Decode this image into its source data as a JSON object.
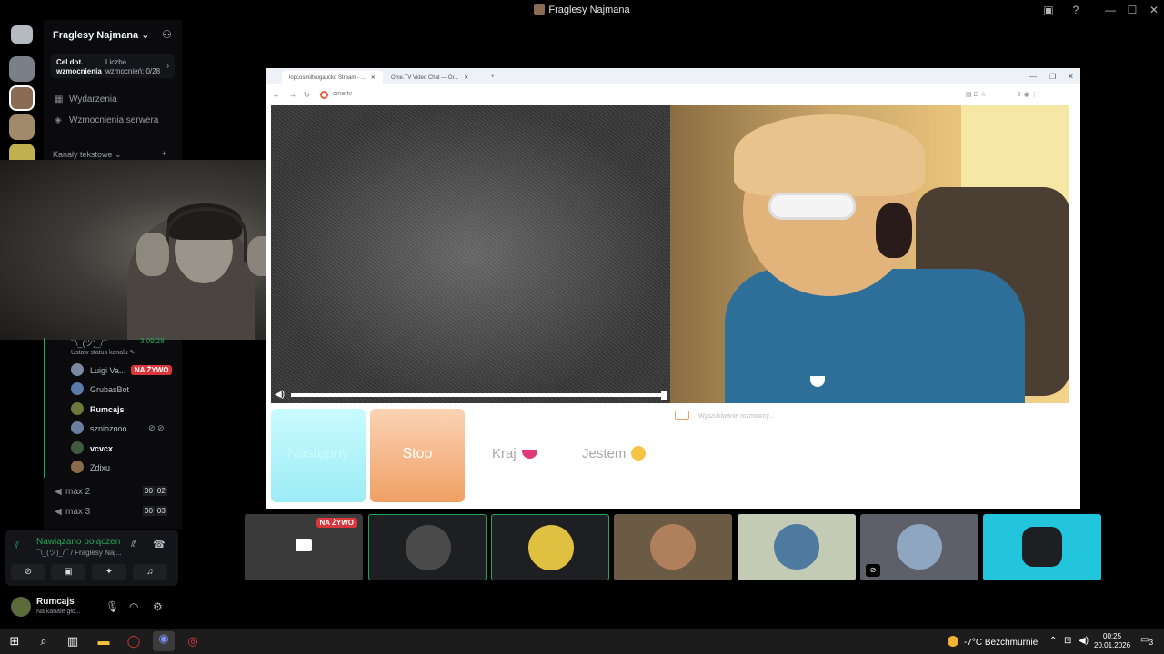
{
  "window": {
    "title": "Fraglesy Najmana",
    "controls": {
      "minimize": "—",
      "maximize": "☐",
      "close": "✕"
    }
  },
  "server": {
    "name": "Fraglesy Najmana",
    "boost": {
      "goal_label": "Cel dot. wzmocnienia",
      "count_label": "Liczba wzmocnień: 0/28"
    },
    "menu": [
      {
        "label": "Wydarzenia",
        "icon": "calendar-icon"
      },
      {
        "label": "Wzmocnienia serwera",
        "icon": "boost-icon"
      }
    ],
    "category": "Kanały tekstowe"
  },
  "voice_channel": {
    "name": "¯\\_(ツ)_/¯",
    "timer": "3:09:28",
    "status_placeholder": "Ustaw status kanału",
    "members": [
      {
        "name": "Luigi Va...",
        "live": "NA ŻYWO",
        "color": "#7a8aa0"
      },
      {
        "name": "GrubasBot",
        "color": "#5a7aa8"
      },
      {
        "name": "Rumcajs",
        "bold": true,
        "color": "#6b7a3c"
      },
      {
        "name": "szniozooo",
        "color": "#6a7fa0"
      },
      {
        "name": "vcvcx",
        "bold": true,
        "color": "#3f5a3f"
      },
      {
        "name": "Zdixu",
        "color": "#8a6a4a"
      }
    ],
    "other_channels": [
      {
        "name": "max 2",
        "a": "00",
        "b": "02"
      },
      {
        "name": "max 3",
        "a": "00",
        "b": "03"
      }
    ]
  },
  "voice_panel": {
    "status": "Nawiązano połączen",
    "channel": "¯\\_(ツ)_/¯ / Fraglesy Naj..."
  },
  "user": {
    "name": "Rumcajs",
    "status": "Na kanale gło..."
  },
  "browser": {
    "tabs": [
      {
        "title": "lopcosmiltvogaucko Stream - ..."
      },
      {
        "title": "Ome.TV Video Chat — Or..."
      }
    ],
    "url": "ome.tv",
    "buttons": {
      "next": "Następny",
      "stop": "Stop",
      "country": "Kraj",
      "gender": "Jestem"
    },
    "status": "Wyszukiwanie rozmowcy...",
    "progress": 1.0
  },
  "tiles": [
    {
      "bg": "#3a3a3a",
      "live": "NA ŻYWO",
      "screen": true,
      "speaking": false
    },
    {
      "bg": "#1e1f22",
      "avatar": "#4a4a4a",
      "speaking": true
    },
    {
      "bg": "#1e1f22",
      "avatar": "#e0c040",
      "speaking": true
    },
    {
      "bg": "#6b5a44",
      "avatar": "#b0805c",
      "speaking": false
    },
    {
      "bg": "#c4cbb5",
      "avatar": "#4f7aa0",
      "speaking": false
    },
    {
      "bg": "#5d6069",
      "avatar": "#8fa6c0",
      "muted": true,
      "speaking": false
    },
    {
      "bg": "#22c5dc",
      "avatar": "#1e1f22",
      "speaking": false
    }
  ],
  "taskbar": {
    "weather": "-7°C  Bezchmurnie",
    "time": "00:25",
    "date": "20.01.2026",
    "notifications": "3"
  },
  "colors": {
    "accent_green": "#23a55a",
    "live_red": "#da373c",
    "bg": "#000000"
  }
}
